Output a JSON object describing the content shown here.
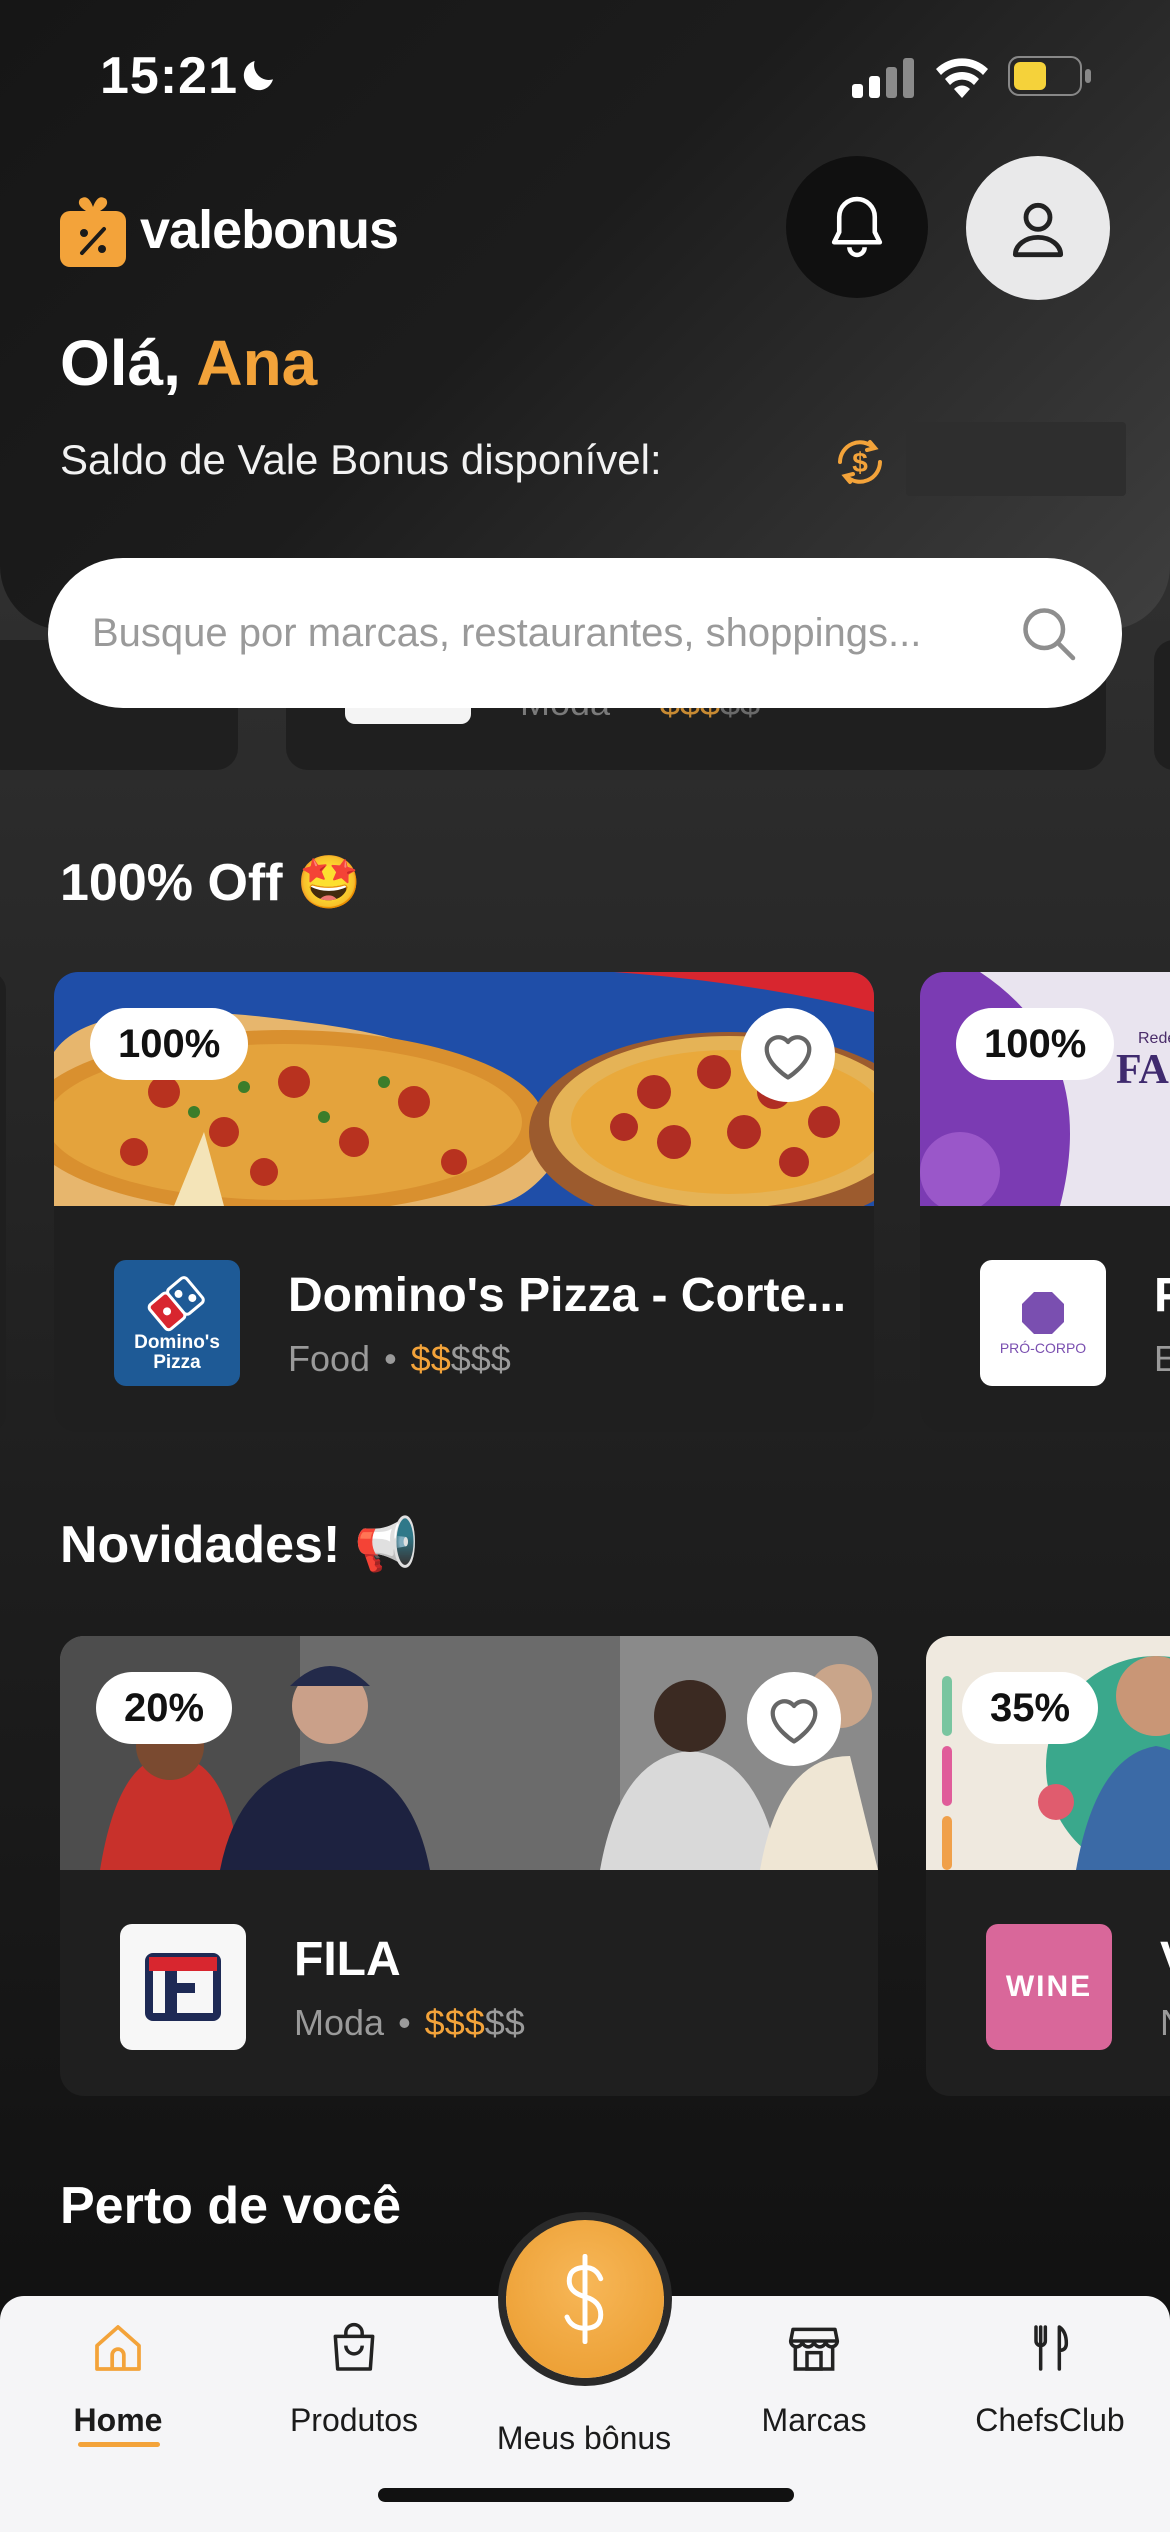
{
  "status_bar": {
    "time": "15:21"
  },
  "app": {
    "logo_text": "valebonus"
  },
  "header": {
    "greeting_prefix": "Olá,",
    "user_name": "Ana",
    "balance_label": "Saldo de Vale Bonus disponível:"
  },
  "search": {
    "placeholder": "Busque por marcas, restaurantes, shoppings..."
  },
  "peek_card": {
    "category": "Moda",
    "price_on": "$$$",
    "price_off": "$$"
  },
  "sections": {
    "off100": {
      "title": "100% Off",
      "emoji": "🤩",
      "cards": [
        {
          "badge": "100%",
          "title": "Domino's Pizza - Corte...",
          "category": "Food",
          "price_on": "$$",
          "price_off": "$$$",
          "logo_text_1": "Domino's",
          "logo_text_2": "Pizza"
        },
        {
          "badge": "100%",
          "title": "P",
          "category": "E",
          "banner_text_1": "Rede",
          "banner_text_2": "FAC",
          "logo_text": "PRÓ-CORPO"
        }
      ]
    },
    "novidades": {
      "title": "Novidades!",
      "emoji": "📢",
      "cards": [
        {
          "badge": "20%",
          "title": "FILA",
          "category": "Moda",
          "price_on": "$$$",
          "price_off": "$$"
        },
        {
          "badge": "35%",
          "title": "V",
          "category": "N",
          "logo_text": "WINE"
        }
      ]
    },
    "perto": {
      "title": "Perto de você"
    }
  },
  "tabbar": {
    "items": [
      {
        "label": "Home",
        "icon": "home-icon",
        "active": true
      },
      {
        "label": "Produtos",
        "icon": "bag-icon"
      },
      {
        "label": "Meus bônus",
        "icon": "dollar-icon"
      },
      {
        "label": "Marcas",
        "icon": "store-icon"
      },
      {
        "label": "ChefsClub",
        "icon": "cutlery-icon"
      }
    ]
  },
  "colors": {
    "accent": "#f3a33a",
    "background": "#262626",
    "card": "#1f1f1f"
  }
}
